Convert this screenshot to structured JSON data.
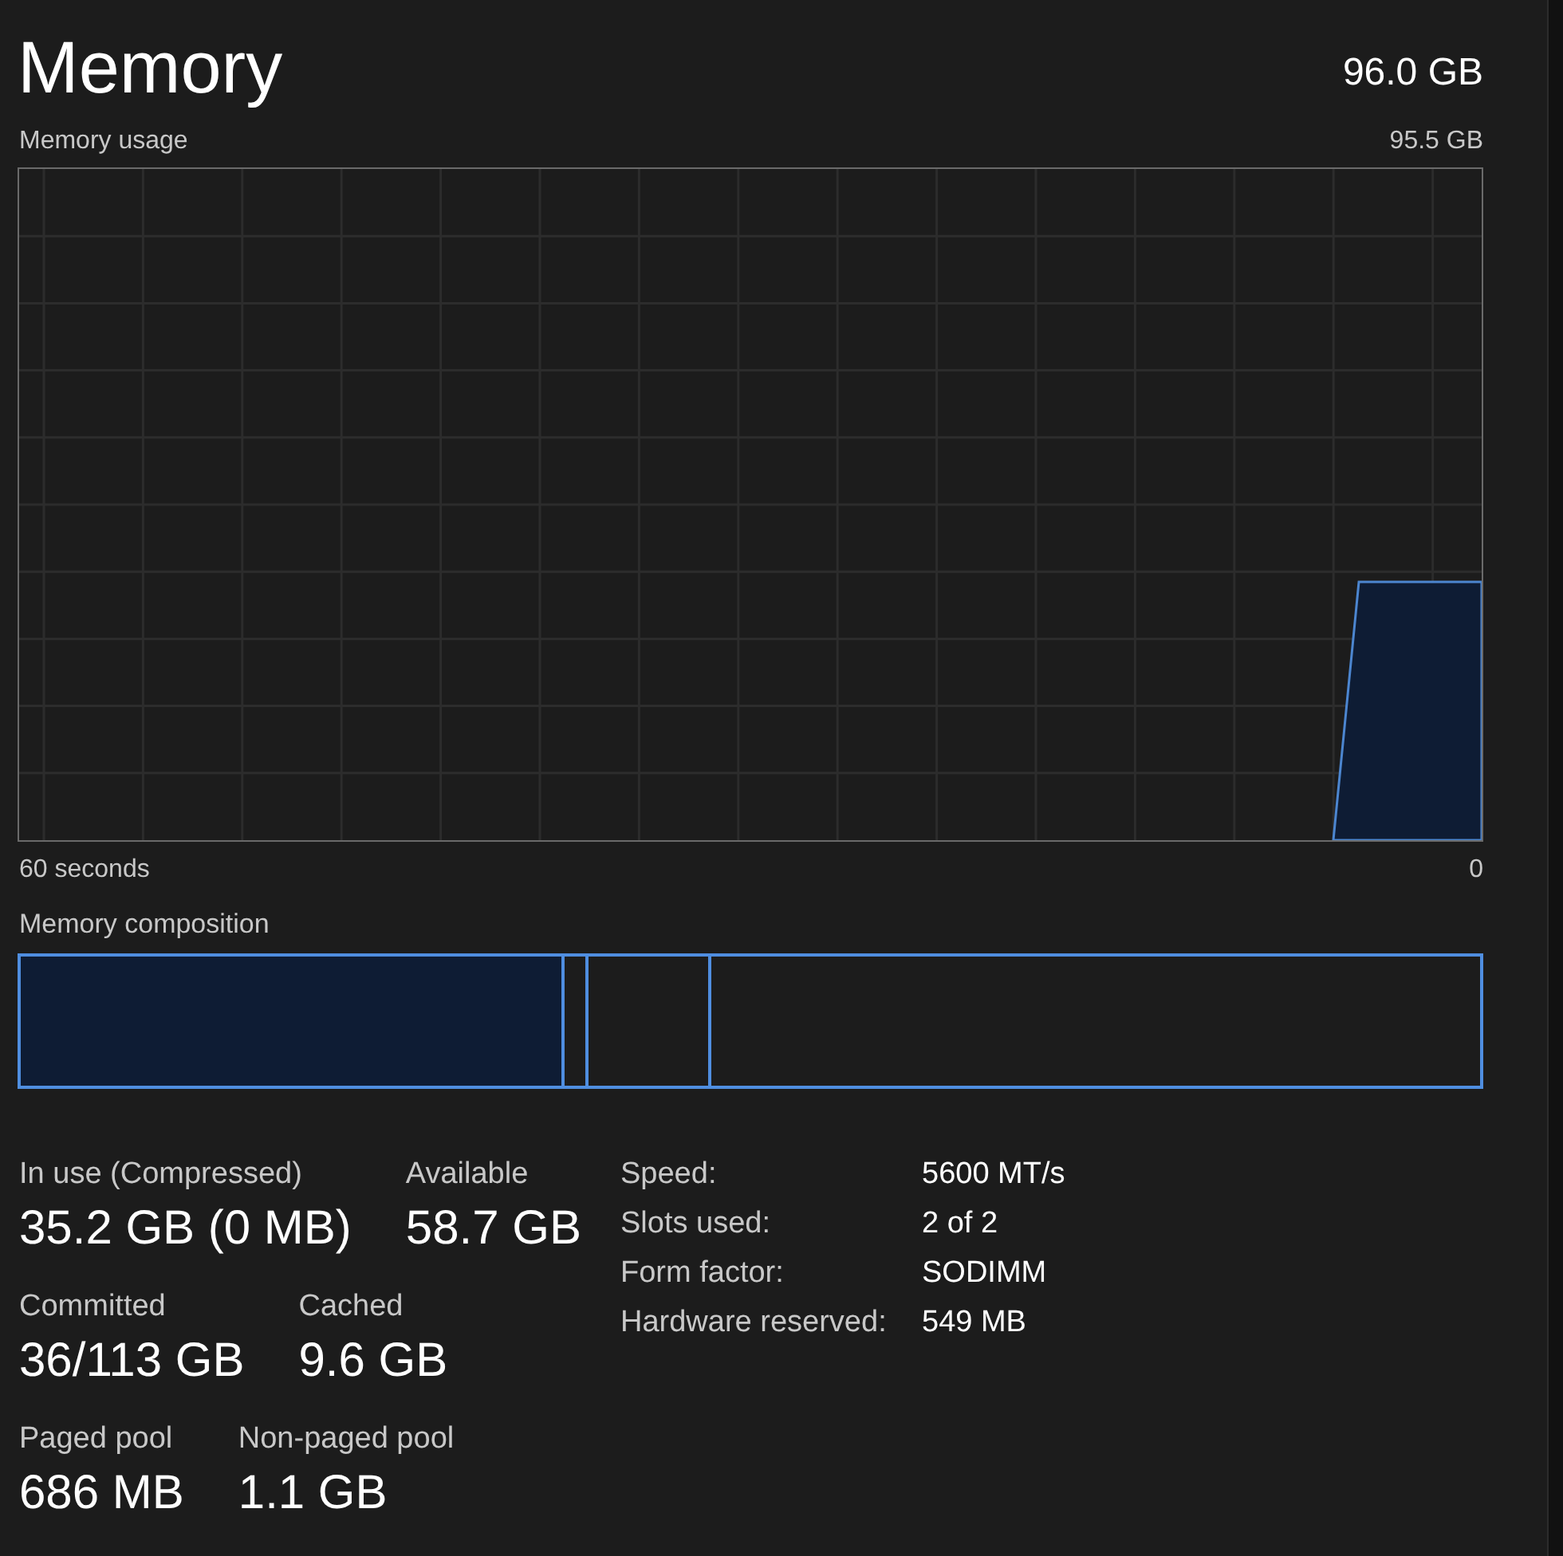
{
  "header": {
    "title": "Memory",
    "total": "96.0 GB"
  },
  "usage_graph": {
    "label": "Memory usage",
    "max": "95.5 GB",
    "time_span": "60 seconds",
    "time_end": "0"
  },
  "composition": {
    "label": "Memory composition"
  },
  "stat_rows": [
    [
      {
        "label": "In use (Compressed)",
        "value": "35.2 GB (0 MB)"
      },
      {
        "label": "Available",
        "value": "58.7 GB"
      }
    ],
    [
      {
        "label": "Committed",
        "value": "36/113 GB"
      },
      {
        "label": "Cached",
        "value": "9.6 GB"
      }
    ],
    [
      {
        "label": "Paged pool",
        "value": "686 MB"
      },
      {
        "label": "Non-paged pool",
        "value": "1.1 GB"
      }
    ]
  ],
  "details": [
    {
      "label": "Speed:",
      "value": "5600 MT/s"
    },
    {
      "label": "Slots used:",
      "value": "2 of 2"
    },
    {
      "label": "Form factor:",
      "value": "SODIMM"
    },
    {
      "label": "Hardware reserved:",
      "value": "549 MB"
    }
  ]
}
